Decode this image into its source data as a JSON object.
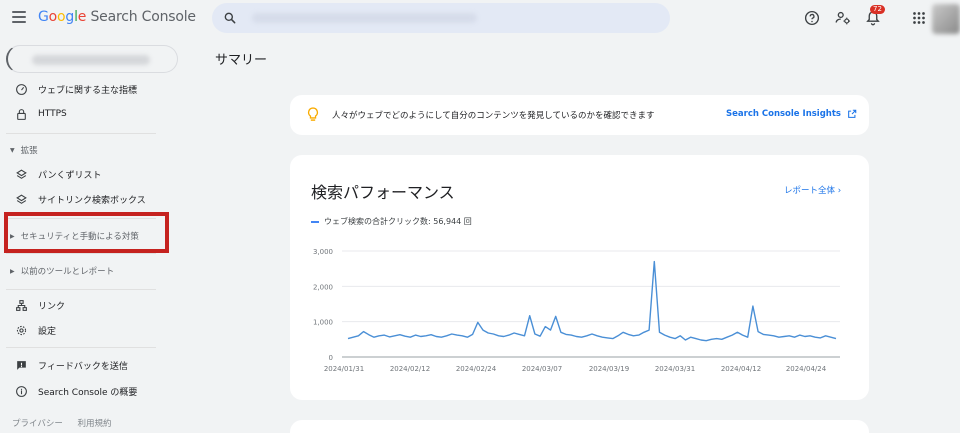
{
  "header": {
    "brand_google": [
      "G",
      "o",
      "o",
      "g",
      "l",
      "e"
    ],
    "brand_product": "Search Console",
    "notifications_count": "72"
  },
  "sidebar": {
    "items_top": [
      {
        "label": "ウェブに関する主な指標",
        "icon": "gauge-icon"
      },
      {
        "label": "HTTPS",
        "icon": "lock-icon"
      }
    ],
    "section_enhancements": "拡張",
    "items_enh": [
      {
        "label": "パンくずリスト",
        "icon": "layers-icon"
      },
      {
        "label": "サイトリンク検索ボックス",
        "icon": "layers-icon"
      }
    ],
    "section_security": "セキュリティと手動による対策",
    "section_legacy": "以前のツールとレポート",
    "items_bottom": [
      {
        "label": "リンク",
        "icon": "links-icon"
      },
      {
        "label": "設定",
        "icon": "gear-icon"
      }
    ],
    "items_footer": [
      {
        "label": "フィードバックを送信",
        "icon": "feedback-icon"
      },
      {
        "label": "Search Console の概要",
        "icon": "info-icon"
      }
    ],
    "footer_links": [
      "プライバシー",
      "利用規約"
    ]
  },
  "main": {
    "page_title": "サマリー",
    "insights": {
      "message": "人々がウェブでどのようにして自分のコンテンツを発見しているのかを確認できます",
      "link": "Search Console Insights"
    },
    "performance": {
      "title": "検索パフォーマンス",
      "report_link": "レポート全体",
      "legend": "ウェブ検索の合計クリック数: 56,944 回"
    }
  },
  "colors": {
    "accent": "#1a73e8",
    "line": "#4a8fd6",
    "highlight": "#c5221f"
  },
  "chart_data": {
    "type": "line",
    "series": [
      {
        "values": [
          520,
          560,
          600,
          720,
          630,
          560,
          600,
          620,
          570,
          600,
          630,
          590,
          560,
          620,
          580,
          600,
          630,
          580,
          560,
          600,
          650,
          620,
          600,
          560,
          640,
          980,
          760,
          680,
          650,
          600,
          580,
          620,
          680,
          640,
          600,
          1170,
          650,
          590,
          860,
          760,
          1150,
          700,
          640,
          620,
          580,
          560,
          600,
          650,
          600,
          560,
          540,
          520,
          600,
          700,
          640,
          600,
          620,
          700,
          760,
          2700,
          700,
          620,
          560,
          520,
          600,
          480,
          560,
          520,
          480,
          460,
          500,
          520,
          500,
          560,
          620,
          700,
          620,
          560,
          1440,
          720,
          640,
          620,
          600,
          560,
          580,
          600,
          560,
          620,
          580,
          600,
          560,
          540,
          600,
          560,
          520
        ]
      }
    ],
    "x_ticks": [
      "2024/01/31",
      "2024/02/12",
      "2024/02/24",
      "2024/03/07",
      "2024/03/19",
      "2024/03/31",
      "2024/04/12",
      "2024/04/24"
    ],
    "y_ticks": [
      "0",
      "1,000",
      "2,000",
      "3,000"
    ],
    "ylim": [
      0,
      3000
    ],
    "grid": true
  }
}
